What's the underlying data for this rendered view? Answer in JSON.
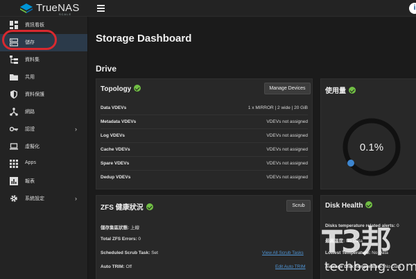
{
  "app": {
    "brand_name": "TrueNAS",
    "brand_sub": "SCALE",
    "user_initial": "i"
  },
  "sidebar": {
    "items": [
      {
        "label": "資訊看板",
        "icon": "dashboard-icon"
      },
      {
        "label": "儲存",
        "icon": "storage-icon",
        "active": true
      },
      {
        "label": "資料集",
        "icon": "datasets-icon"
      },
      {
        "label": "共用",
        "icon": "shares-icon"
      },
      {
        "label": "資料保護",
        "icon": "shield-icon"
      },
      {
        "label": "網路",
        "icon": "network-icon"
      },
      {
        "label": "認證",
        "icon": "key-icon",
        "chevron": "›"
      },
      {
        "label": "虛擬化",
        "icon": "laptop-icon"
      },
      {
        "label": "Apps",
        "icon": "apps-grid-icon"
      },
      {
        "label": "報表",
        "icon": "reports-icon"
      },
      {
        "label": "系統設定",
        "icon": "gear-icon",
        "chevron": "›"
      }
    ]
  },
  "main": {
    "page_title": "Storage Dashboard",
    "section_title": "Drive",
    "topology": {
      "title": "Topology",
      "button_label": "Manage Devices",
      "rows": [
        {
          "label": "Data VDEVs",
          "value": "1 x MIRROR | 2 wide | 20 GiB"
        },
        {
          "label": "Metadata VDEVs",
          "value": "VDEVs not assigned"
        },
        {
          "label": "Log VDEVs",
          "value": "VDEVs not assigned"
        },
        {
          "label": "Cache VDEVs",
          "value": "VDEVs not assigned"
        },
        {
          "label": "Spare VDEVs",
          "value": "VDEVs not assigned"
        },
        {
          "label": "Dedup VDEVs",
          "value": "VDEVs not assigned"
        }
      ]
    },
    "usage": {
      "title": "使用量",
      "percent_text": "0.1%",
      "percent_value": 0.1
    },
    "zfs_health": {
      "title": "ZFS 健康狀況",
      "button_label": "Scrub",
      "pool_status_label": "儲存集區狀態:",
      "pool_status_value": "上線",
      "total_errors_label": "Total ZFS Errors:",
      "total_errors_value": "0",
      "scrub_task_label": "Scheduled Scrub Task:",
      "scrub_task_value": "Set",
      "scrub_task_link": "View All Scrub Tasks",
      "auto_trim_label": "Auto TRIM:",
      "auto_trim_value": "Off",
      "auto_trim_link": "Edit Auto TRIM"
    },
    "disk_health": {
      "title": "Disk Health",
      "alerts_label": "Disks temperature related alerts:",
      "alerts_value": "0",
      "highest_label": "最高溫度:",
      "highest_value": "No Data",
      "lowest_label": "Lowest Temperature:",
      "lowest_value": "No Data",
      "average_label": "Average Disk Temperature:",
      "average_value": "No Data"
    }
  },
  "watermark": {
    "text": "techbang.com"
  },
  "colors": {
    "accent_blue": "#4f94d4",
    "healthy_green": "#71bf44",
    "highlight_red": "#d8292f",
    "gauge_blue": "#3d86d0"
  }
}
